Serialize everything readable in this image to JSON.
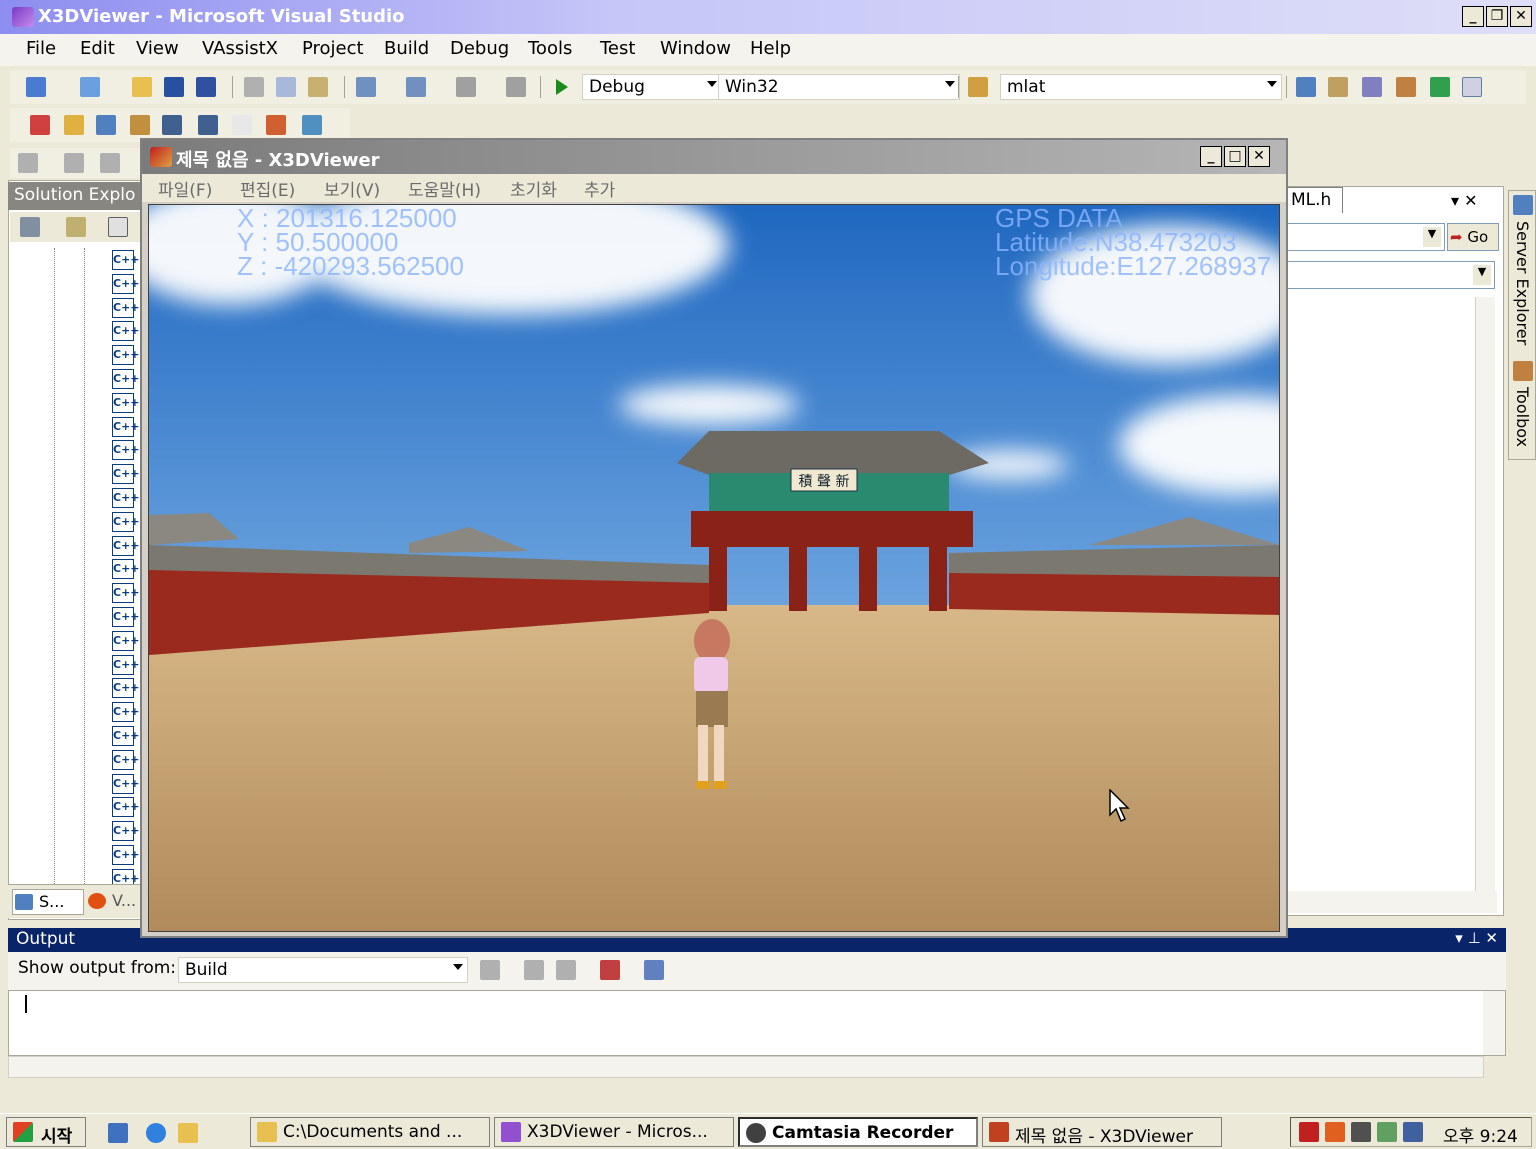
{
  "vs": {
    "title": "X3DViewer - Microsoft Visual Studio",
    "menu": [
      "File",
      "Edit",
      "View",
      "VAssistX",
      "Project",
      "Build",
      "Debug",
      "Tools",
      "Test",
      "Window",
      "Help"
    ],
    "config": "Debug",
    "platform": "Win32",
    "find_value": "mlat",
    "window_buttons": [
      "_",
      "̅",
      "x"
    ]
  },
  "solution_explorer": {
    "title": "Solution Explo",
    "file_glyph": "C++",
    "tab_solution": "S...",
    "tab_vax": "V..."
  },
  "right_pane": {
    "tab": "ML.h",
    "go": "Go",
    "server_explorer": "Server Explorer",
    "toolbox": "Toolbox"
  },
  "viewer": {
    "title": "제목 없음 - X3DViewer",
    "menu": [
      "파일(F)",
      "편집(E)",
      "보기(V)",
      "도움말(H)",
      "초기화",
      "추가"
    ],
    "hud": {
      "x": "X : 201316.125000",
      "y": "Y : 50.500000",
      "z": "Z : -420293.562500",
      "gps_title": "GPS DATA",
      "lat": "Latitude:N38.473203",
      "lon": "Longitude:E127.268937"
    },
    "sign": "積 聲 新"
  },
  "output": {
    "title": "Output",
    "show_label": "Show output from:",
    "source": "Build"
  },
  "taskbar": {
    "start": "시작",
    "tasks": [
      "C:\\Documents and ...",
      "X3DViewer - Micros...",
      "Camtasia Recorder",
      "제목 없음 - X3DViewer"
    ],
    "clock": "오후 9:24"
  },
  "colors": {
    "vs_title_active": "#8d8df0",
    "output_header": "#0a246a",
    "sky": "#2a78c8",
    "ground": "#c8a06a",
    "wall_red": "#9a2a1e"
  }
}
